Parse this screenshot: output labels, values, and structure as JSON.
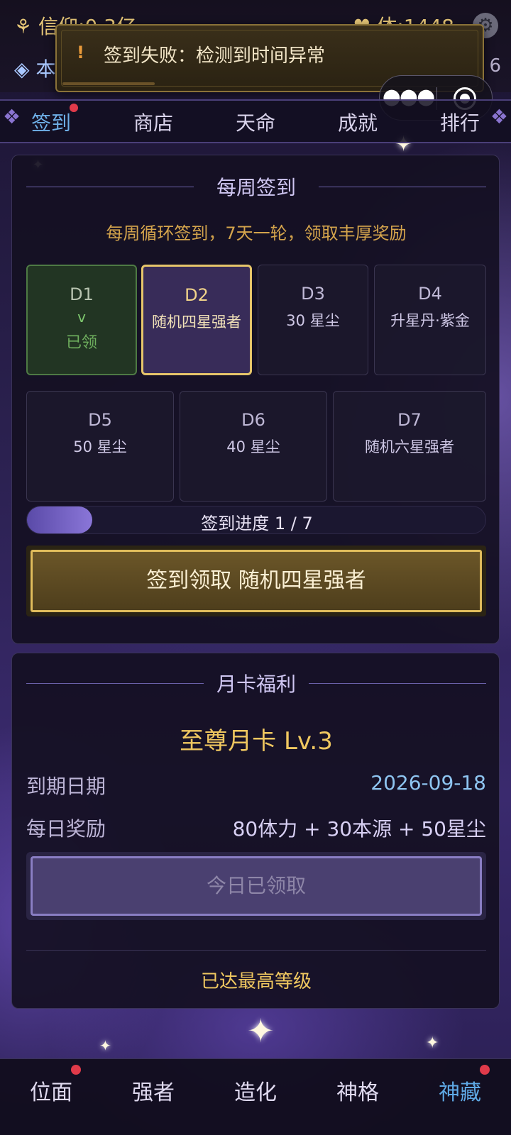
{
  "resources": {
    "faith": "信仰:0.3亿",
    "origin": "本",
    "stamina": "体:1448",
    "right_number": "6"
  },
  "toast": {
    "icon": "!",
    "message": "签到失败：检测到时间异常"
  },
  "capsule": {
    "more_icon": "more-dots-icon",
    "close_icon": "close-target-icon"
  },
  "tabs": [
    {
      "label": "签到",
      "active": true,
      "badge": true
    },
    {
      "label": "商店",
      "active": false,
      "badge": false
    },
    {
      "label": "天命",
      "active": false,
      "badge": false
    },
    {
      "label": "成就",
      "active": false,
      "badge": false
    },
    {
      "label": "排行",
      "active": false,
      "badge": false
    }
  ],
  "weekly": {
    "title": "每周签到",
    "subtitle": "每周循环签到，7天一轮，领取丰厚奖励",
    "days": [
      {
        "label": "D1",
        "check": "v",
        "status": "已领",
        "state": "claimed"
      },
      {
        "label": "D2",
        "reward": "随机四星强者",
        "state": "today"
      },
      {
        "label": "D3",
        "reward": "30 星尘",
        "state": "locked"
      },
      {
        "label": "D4",
        "reward": "升星丹·紫金",
        "state": "locked"
      },
      {
        "label": "D5",
        "reward": "50 星尘",
        "state": "locked"
      },
      {
        "label": "D6",
        "reward": "40 星尘",
        "state": "locked"
      },
      {
        "label": "D7",
        "reward": "随机六星强者",
        "state": "locked"
      }
    ],
    "progress_text": "签到进度  1 / 7",
    "progress_fraction": 0.143,
    "claim_button": "签到领取  随机四星强者"
  },
  "monthly": {
    "title": "月卡福利",
    "level": "至尊月卡 Lv.3",
    "expiry_label": "到期日期",
    "expiry_value": "2026-09-18",
    "daily_label": "每日奖励",
    "daily_value": "80体力 + 30本源 + 50星尘",
    "claimed_button": "今日已领取",
    "max_level_text": "已达最高等级"
  },
  "bottom_nav": [
    {
      "label": "位面",
      "active": false,
      "badge": true
    },
    {
      "label": "强者",
      "active": false,
      "badge": false
    },
    {
      "label": "造化",
      "active": false,
      "badge": false
    },
    {
      "label": "神格",
      "active": false,
      "badge": false
    },
    {
      "label": "神藏",
      "active": true,
      "badge": true
    }
  ],
  "colors": {
    "accent_gold": "#e6c56a",
    "active_blue": "#6fb0e8",
    "badge_red": "#e03a4a",
    "claimed_green": "#6fb05e"
  }
}
